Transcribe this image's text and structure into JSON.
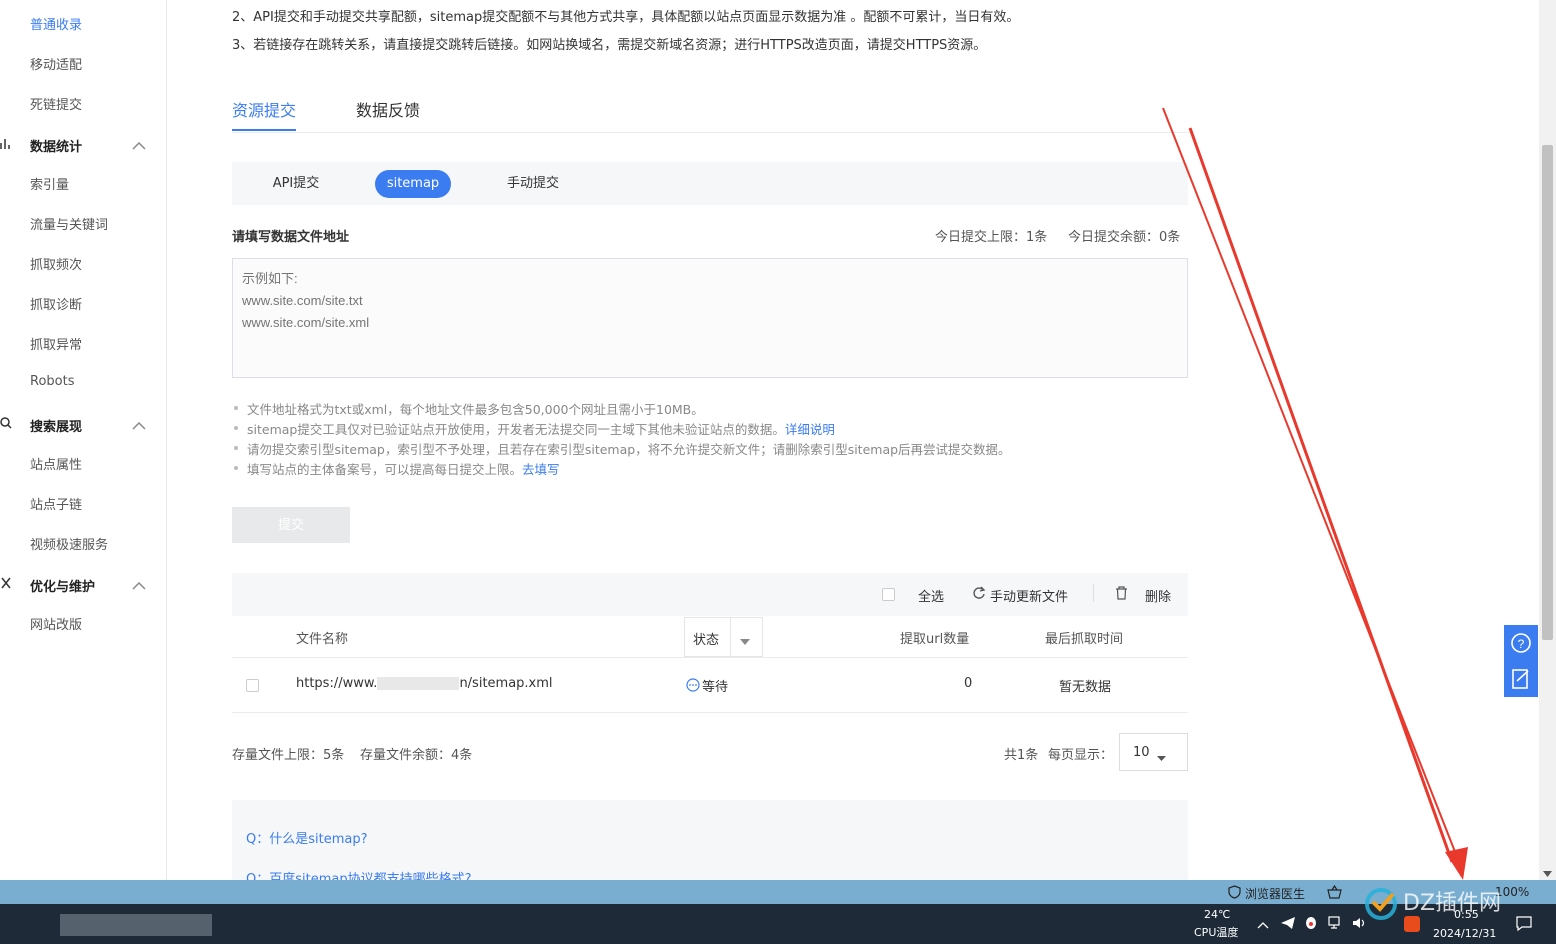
{
  "sidebar": {
    "items_top": [
      "普通收录",
      "移动适配",
      "死链提交"
    ],
    "groups": [
      {
        "title": "数据统计",
        "items": [
          "索引量",
          "流量与关键词",
          "抓取频次",
          "抓取诊断",
          "抓取异常",
          "Robots"
        ]
      },
      {
        "title": "搜索展现",
        "items": [
          "站点属性",
          "站点子链",
          "视频极速服务"
        ]
      },
      {
        "title": "优化与维护",
        "items": [
          "网站改版"
        ]
      }
    ]
  },
  "notices": [
    "2、API提交和手动提交共享配额，sitemap提交配额不与其他方式共享，具体配额以站点页面显示数据为准 。配额不可累计，当日有效。",
    "3、若链接存在跳转关系，请直接提交跳转后链接。如网站换域名，需提交新域名资源；进行HTTPS改造页面，请提交HTTPS资源。"
  ],
  "tabs": [
    "资源提交",
    "数据反馈"
  ],
  "subtabs": [
    "API提交",
    "sitemap",
    "手动提交"
  ],
  "form": {
    "label": "请填写数据文件地址",
    "quota_limit": "今日提交上限：1条",
    "quota_left": "今日提交余额：0条",
    "placeholder": "示例如下:\nwww.site.com/site.txt\nwww.site.com/site.xml",
    "submit": "提交"
  },
  "tips": {
    "t1": "文件地址格式为txt或xml，每个地址文件最多包含50,000个网址且需小于10MB。",
    "t2": "sitemap提交工具仅对已验证站点开放使用，开发者无法提交同一主域下其他未验证站点的数据。",
    "t2_link": "详细说明",
    "t3": "请勿提交索引型sitemap，索引型不予处理，且若存在索引型sitemap，将不允许提交新文件；请删除索引型sitemap后再尝试提交数据。",
    "t4": "填写站点的主体备案号，可以提高每日提交上限。",
    "t4_link": "去填写"
  },
  "toolbar": {
    "select_all": "全选",
    "refresh": "手动更新文件",
    "delete": "删除"
  },
  "table": {
    "headers": {
      "name": "文件名称",
      "status": "状态",
      "url_count": "提取url数量",
      "last_crawl": "最后抓取时间"
    },
    "rows": [
      {
        "name_prefix": "https://www.",
        "name_suffix": "n/sitemap.xml",
        "status": "等待",
        "url_count": "0",
        "last_crawl": "暂无数据"
      }
    ]
  },
  "footer": {
    "storage_limit": "存量文件上限：5条",
    "storage_left": "存量文件余额：4条",
    "total": "共1条",
    "per_page_label": "每页显示：",
    "per_page": "10"
  },
  "faq": [
    "Q：什么是sitemap?",
    "Q：百度sitemap协议都支持哪些格式?"
  ],
  "taskbar": {
    "browser_doctor": "浏览器医生",
    "temp": "24℃",
    "cpu": "CPU温度",
    "time": "0:55",
    "date": "2024/12/31",
    "zoom": "100%",
    "watermark": "DZ插件网"
  },
  "colors": {
    "accent": "#3b7cf0",
    "arrow": "#e8392c",
    "taskbar": "#1e2a38",
    "statusbar": "#7aaed0"
  }
}
